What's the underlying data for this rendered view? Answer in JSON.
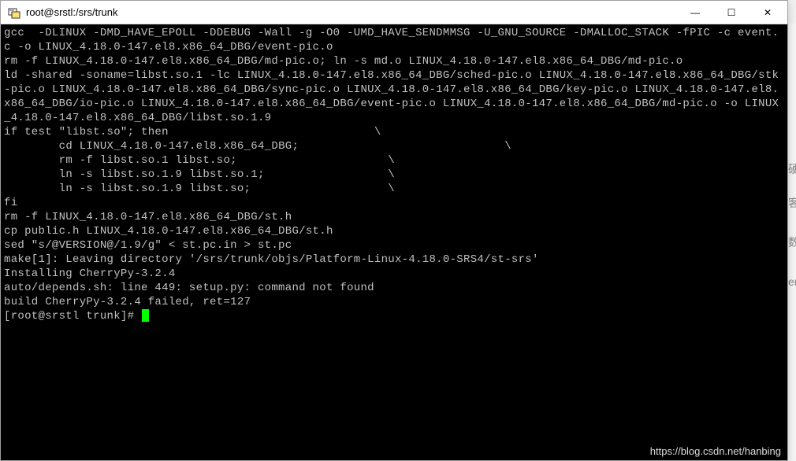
{
  "window": {
    "title": "root@srstl:/srs/trunk",
    "icon_name": "putty-icon"
  },
  "controls": {
    "minimize": "—",
    "maximize": "☐",
    "close": "✕"
  },
  "terminal": {
    "lines": [
      "gcc  -DLINUX -DMD_HAVE_EPOLL -DDEBUG -Wall -g -O0 -UMD_HAVE_SENDMMSG -U_GNU_SOURCE -DMALLOC_STACK -fPIC -c event.c -o LINUX_4.18.0-147.el8.x86_64_DBG/event-pic.o",
      "rm -f LINUX_4.18.0-147.el8.x86_64_DBG/md-pic.o; ln -s md.o LINUX_4.18.0-147.el8.x86_64_DBG/md-pic.o",
      "ld -shared -soname=libst.so.1 -lc LINUX_4.18.0-147.el8.x86_64_DBG/sched-pic.o LINUX_4.18.0-147.el8.x86_64_DBG/stk-pic.o LINUX_4.18.0-147.el8.x86_64_DBG/sync-pic.o LINUX_4.18.0-147.el8.x86_64_DBG/key-pic.o LINUX_4.18.0-147.el8.x86_64_DBG/io-pic.o LINUX_4.18.0-147.el8.x86_64_DBG/event-pic.o LINUX_4.18.0-147.el8.x86_64_DBG/md-pic.o -o LINUX_4.18.0-147.el8.x86_64_DBG/libst.so.1.9",
      "if test \"libst.so\"; then                              \\",
      "        cd LINUX_4.18.0-147.el8.x86_64_DBG;                              \\",
      "        rm -f libst.so.1 libst.so;                      \\",
      "        ln -s libst.so.1.9 libst.so.1;                  \\",
      "        ln -s libst.so.1.9 libst.so;                    \\",
      "fi",
      "rm -f LINUX_4.18.0-147.el8.x86_64_DBG/st.h",
      "cp public.h LINUX_4.18.0-147.el8.x86_64_DBG/st.h",
      "sed \"s/@VERSION@/1.9/g\" < st.pc.in > st.pc",
      "make[1]: Leaving directory '/srs/trunk/objs/Platform-Linux-4.18.0-SRS4/st-srs'",
      "Installing CherryPy-3.2.4",
      "auto/depends.sh: line 449: setup.py: command not found",
      "build CherryPy-3.2.4 failed, ret=127"
    ],
    "prompt": "[root@srstl trunk]# "
  },
  "watermark": "https://blog.csdn.net/hanbing",
  "bg_chars": {
    "c1": "硬",
    "c2": "客",
    "c3": "数",
    "c4": "er"
  }
}
